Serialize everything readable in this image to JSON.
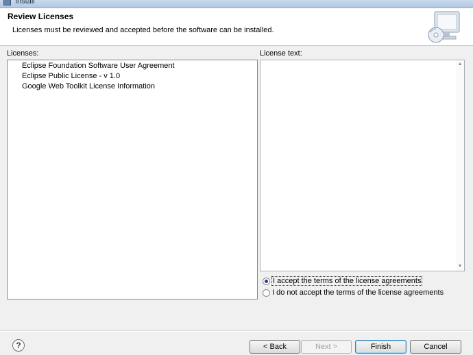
{
  "window": {
    "title": "Install"
  },
  "header": {
    "title": "Review Licenses",
    "description": "Licenses must be reviewed and accepted before the software can be installed.",
    "icon": "wizard-computer-cd-icon"
  },
  "licenses": {
    "label": "Licenses:",
    "items": [
      "Eclipse Foundation Software User Agreement",
      "Eclipse Public License - v 1.0",
      "Google Web Toolkit License Information"
    ]
  },
  "license_text": {
    "label": "License text:",
    "content": ""
  },
  "options": [
    {
      "label": "I accept the terms of the license agreements",
      "checked": true
    },
    {
      "label": "I do not accept the terms of the license agreements",
      "checked": false
    }
  ],
  "footer": {
    "help_icon": "help-icon",
    "help_glyph": "?",
    "buttons": {
      "back": "< Back",
      "next": "Next >",
      "finish": "Finish",
      "cancel": "Cancel"
    }
  }
}
